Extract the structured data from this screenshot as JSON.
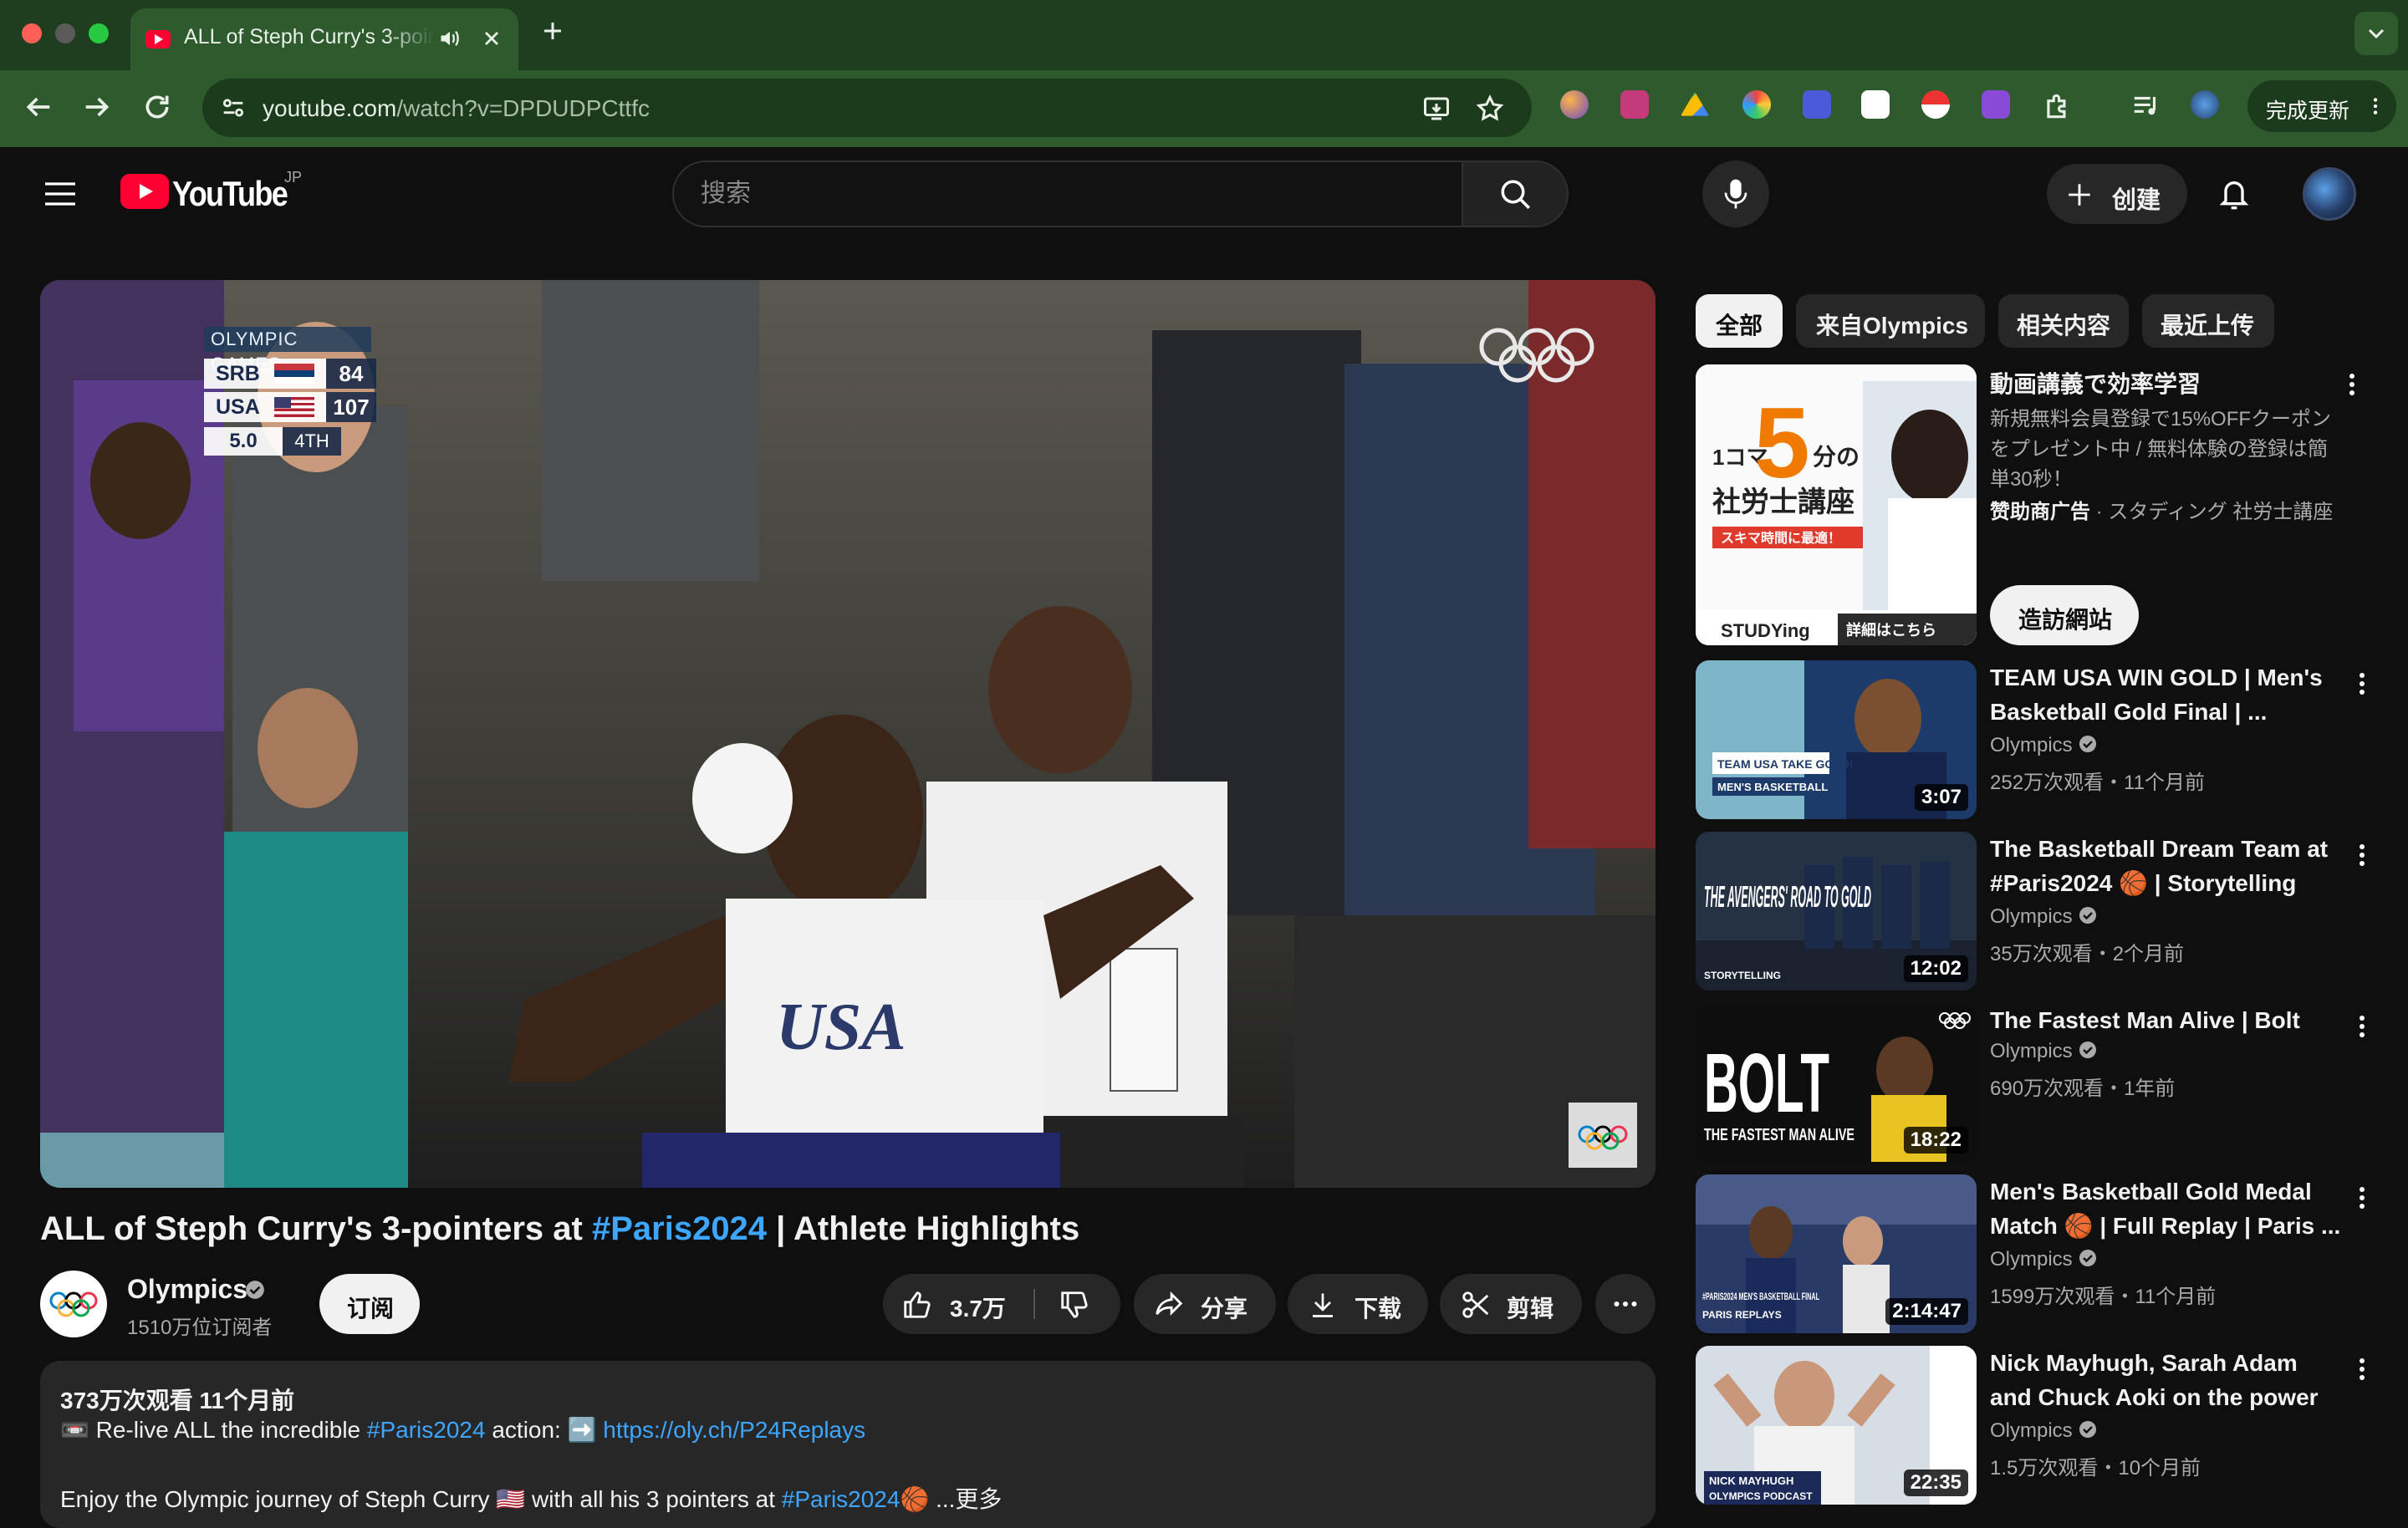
{
  "browser": {
    "tab_title": "ALL of Steph Curry's 3-pointers at #Paris2024 | Athlete Highlights",
    "url_host": "youtube.com",
    "url_path": "/watch?v=DPDUDPCttfc",
    "update_label": "完成更新"
  },
  "header": {
    "logo_text": "YouTube",
    "region": "JP",
    "search_placeholder": "搜索",
    "create_label": "创建"
  },
  "player": {
    "scorebug": {
      "header": "OLYMPIC GAMES",
      "team1": "SRB",
      "score1": "84",
      "team2": "USA",
      "score2": "107",
      "clock": "5.0",
      "quarter": "4TH"
    }
  },
  "video": {
    "title_prefix": "ALL of Steph Curry's 3-pointers at ",
    "title_tag": "#Paris2024",
    "title_suffix": " | Athlete Highlights",
    "channel_name": "Olympics",
    "subscribers": "1510万位订阅者",
    "subscribe_label": "订阅",
    "likes": "3.7万",
    "share_label": "分享",
    "download_label": "下载",
    "clip_label": "剪辑"
  },
  "description": {
    "meta": "373万次观看  11个月前",
    "line1_prefix": "📼 Re-live ALL the incredible ",
    "line1_tag": "#Paris2024",
    "line1_mid": " action: ➡️ ",
    "line1_link": "https://oly.ch/P24Replays",
    "line2_prefix": "Enjoy the Olympic journey of Steph Curry 🇺🇸 with all his 3 pointers at ",
    "line2_tag": "#Paris2024",
    "line2_suffix": "🏀 ...更多"
  },
  "sidebar": {
    "chips": [
      "全部",
      "来自Olympics",
      "相关内容",
      "最近上传"
    ],
    "ad": {
      "title": "動画講義で効率学習",
      "desc": "新規無料会員登録で15%OFFクーポンをプレゼント中 / 無料体験の登録は簡単30秒！",
      "sponsor_label": "赞助商广告",
      "sponsor_name": " · スタディング 社労士講座",
      "visit_label": "造訪網站",
      "thumb_big": "5",
      "thumb_line1_a": "1コマ",
      "thumb_line1_b": "分の",
      "thumb_line2": "社労士講座",
      "thumb_banner": "スキマ時間に最適！",
      "thumb_brand": "STUDYing",
      "thumb_more": "詳細はこちら"
    },
    "videos": [
      {
        "title": "TEAM USA WIN GOLD | Men's Basketball Gold Final | ...",
        "channel": "Olympics",
        "stats": "252万次观看・11个月前",
        "duration": "3:07",
        "thumb_caption1": "TEAM USA TAKE GOLD!",
        "thumb_caption2": "MEN'S BASKETBALL"
      },
      {
        "title": "The Basketball Dream Team at #Paris2024 🏀 | Storytelling",
        "channel": "Olympics",
        "stats": "35万次观看・2个月前",
        "duration": "12:02",
        "thumb_caption1": "THE AVENGERS' ROAD TO GOLD",
        "thumb_caption2": "STORYTELLING"
      },
      {
        "title": "The Fastest Man Alive | Bolt",
        "channel": "Olympics",
        "stats": "690万次观看・1年前",
        "duration": "18:22",
        "thumb_caption1": "BOLT",
        "thumb_caption2": "THE FASTEST MAN ALIVE"
      },
      {
        "title": "Men's Basketball Gold Medal Match 🏀 | Full Replay | Paris ...",
        "channel": "Olympics",
        "stats": "1599万次观看・11个月前",
        "duration": "2:14:47",
        "thumb_caption1": "#PARIS2024 MEN'S BASKETBALL FINAL",
        "thumb_caption2": "PARIS REPLAYS"
      },
      {
        "title": "Nick Mayhugh, Sarah Adam and Chuck Aoki on the power of th...",
        "channel": "Olympics",
        "stats": "1.5万次观看・10个月前",
        "duration": "22:35",
        "thumb_caption1": "NICK MAYHUGH",
        "thumb_caption2": "OLYMPICS PODCAST"
      }
    ]
  },
  "colors": {
    "browser_frame": "#1f3d1f",
    "toolbar": "#2e5a2e",
    "yt_bg": "#0f0f0f",
    "yt_red": "#ff0033",
    "link_blue": "#3ea6ff"
  }
}
